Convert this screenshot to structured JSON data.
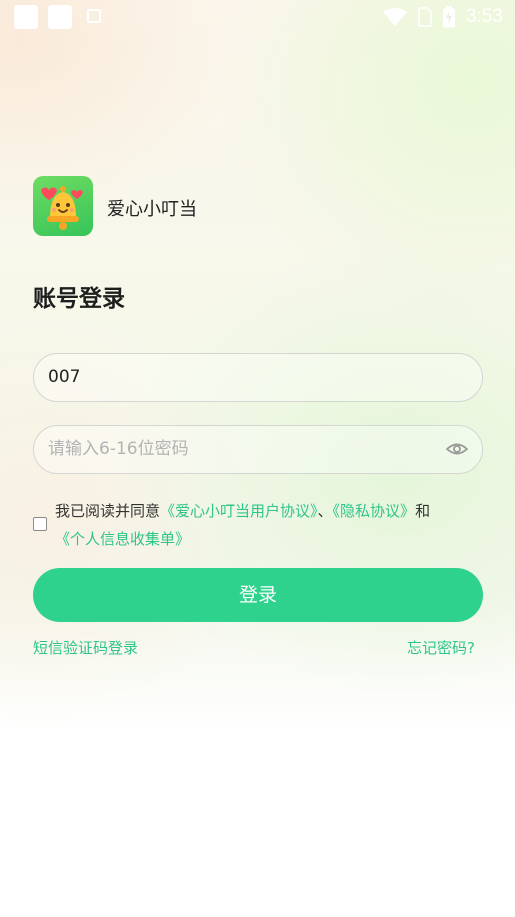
{
  "status_bar": {
    "time": "3:53",
    "icons": [
      "notification-square-icon",
      "notification-square-icon",
      "image-icon",
      "wifi-icon",
      "sim-icon",
      "battery-icon"
    ]
  },
  "app": {
    "name": "爱心小叮当",
    "logo_icon": "bell-mascot-icon"
  },
  "page_title": "账号登录",
  "form": {
    "account_value": "007",
    "password_value": "",
    "password_placeholder": "请输入6-16位密码",
    "password_toggle_icon": "eye-icon"
  },
  "agreement": {
    "checked": false,
    "prefix": "我已阅读并同意",
    "user_agreement": "《爱心小叮当用户协议》",
    "separator": "、",
    "privacy_policy": "《隐私协议》",
    "conjunction": "和",
    "info_collection": "《个人信息收集单》"
  },
  "login_button": "登录",
  "sms_login_link": "短信验证码登录",
  "forgot_password_link": "忘记密码?",
  "colors": {
    "accent": "#2fd28c",
    "link": "#2fc58a"
  }
}
